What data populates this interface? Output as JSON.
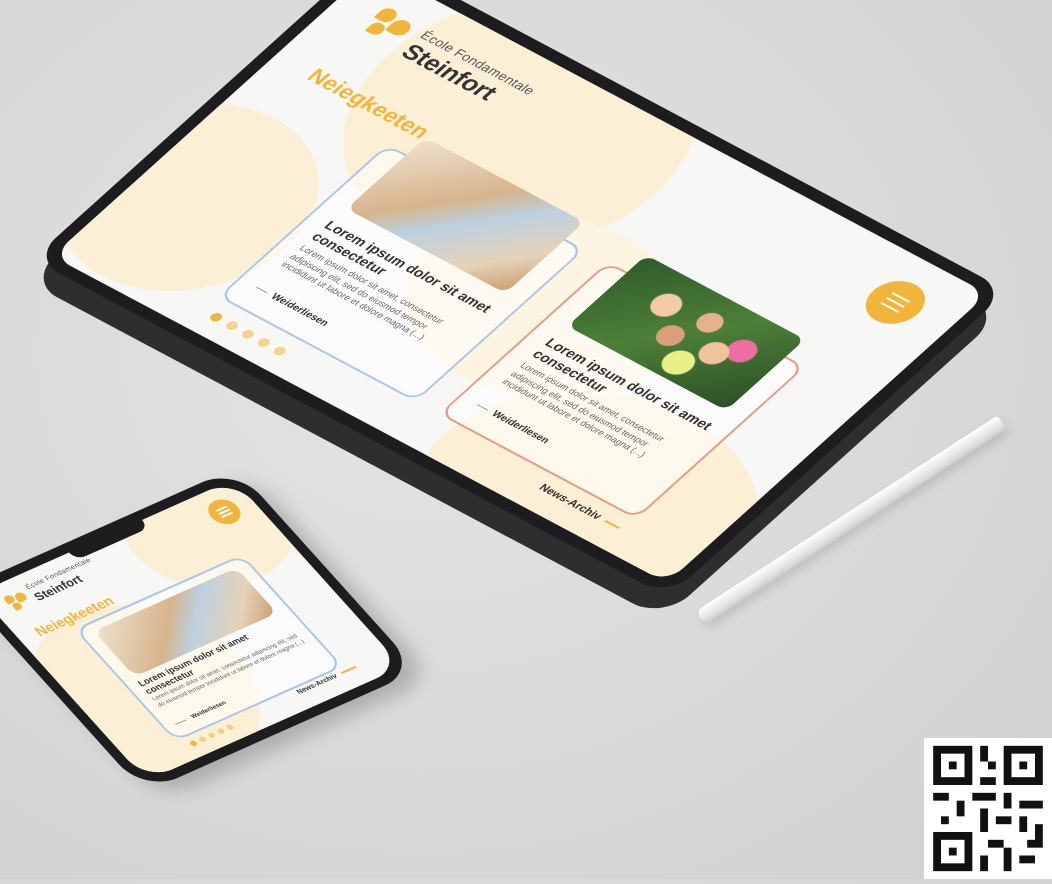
{
  "brand": {
    "name_small": "École Fondamentale",
    "name_big": "Steinfort"
  },
  "news_section": {
    "title": "Neiegkeeten",
    "archive_link": "News-Archiv"
  },
  "cards": [
    {
      "heading": "Lorem ipsum dolor sit amet consectetur",
      "body": "Lorem ipsum dolor sit amet, consectetur adipiscing elit, sed do eiusmod tempor incididunt ut labore et dolore magna (...)",
      "link": "Weiderliesen",
      "photo": "child-writing-photo"
    },
    {
      "heading": "Lorem ipsum dolor sit amet consectetur",
      "body": "Lorem ipsum dolor sit amet, consectetur adipiscing elit, sed do eiusmod tempor incididunt ut labore et dolore magna (...)",
      "link": "Weiderliesen",
      "photo": "children-on-grass-photo"
    }
  ],
  "icons": {
    "menu": "hamburger-menu-icon",
    "logo": "petal-logo-icon"
  },
  "colors": {
    "accent": "#f2b53c",
    "blob": "#fbefd6",
    "card_border_blue": "#a9c6e8",
    "card_border_red": "#e59a86",
    "device_frame": "#1d1d1f",
    "background": "#d9d9d9"
  },
  "carousel": {
    "dots": 5,
    "active_index": 0
  }
}
